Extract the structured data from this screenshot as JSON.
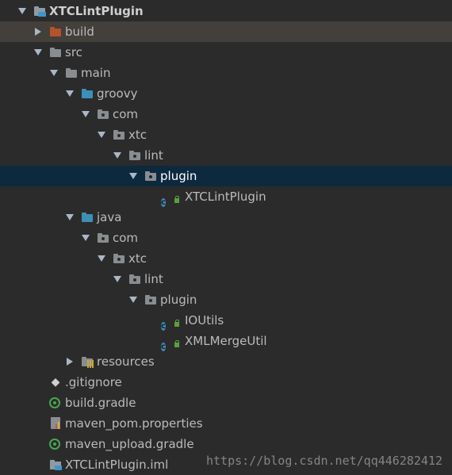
{
  "tree": {
    "project": "XTCLintPlugin",
    "build": "build",
    "src": "src",
    "main": "main",
    "groovy": "groovy",
    "groovy_com": "com",
    "groovy_xtc": "xtc",
    "groovy_lint": "lint",
    "groovy_plugin": "plugin",
    "groovy_class": "XTCLintPlugin",
    "java": "java",
    "java_com": "com",
    "java_xtc": "xtc",
    "java_lint": "lint",
    "java_plugin": "plugin",
    "java_class_1": "IOUtils",
    "java_class_2": "XMLMergeUtil",
    "resources": "resources",
    "gitignore": ".gitignore",
    "build_gradle": "build.gradle",
    "maven_pom": "maven_pom.properties",
    "maven_upload": "maven_upload.gradle",
    "iml": "XTCLintPlugin.iml"
  },
  "class_icon_letter": "c",
  "watermark": "https://blog.csdn.net/qq446282412",
  "colors": {
    "background": "#2b2b2b",
    "selection": "#0d293e",
    "build_highlight": "#433f3a",
    "folder_blue": "#3d8fb8",
    "folder_orange": "#b4532a",
    "gradle_green": "#46a84e"
  }
}
